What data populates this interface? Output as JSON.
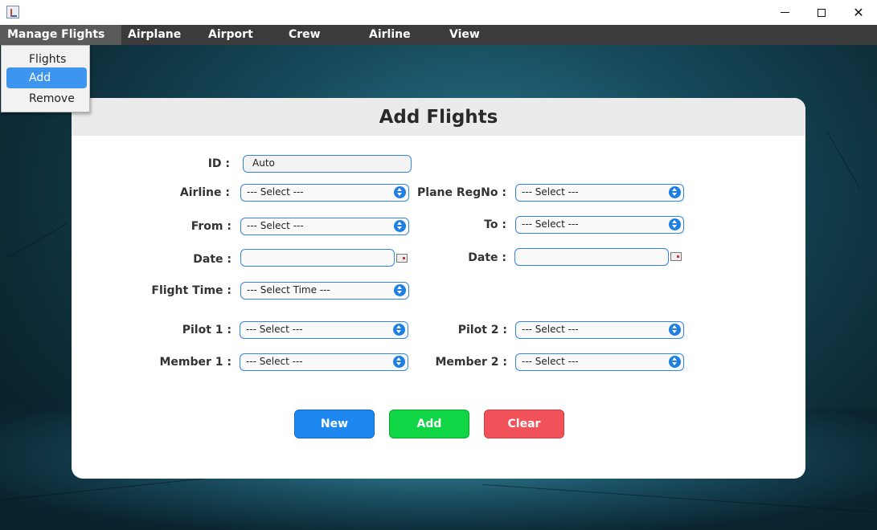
{
  "window": {
    "minimize_glyph": "",
    "close_glyph": "✕"
  },
  "menubar": {
    "items": [
      {
        "label": "Manage Flights"
      },
      {
        "label": "Airplane"
      },
      {
        "label": "Airport"
      },
      {
        "label": "Crew"
      },
      {
        "label": "Airline"
      },
      {
        "label": "View"
      }
    ]
  },
  "dropdown": {
    "items": [
      {
        "label": "Flights"
      },
      {
        "label": "Add"
      },
      {
        "label": "Remove"
      }
    ]
  },
  "form": {
    "title": "Add Flights",
    "id": {
      "label": "ID :",
      "value": "Auto"
    },
    "airline": {
      "label": "Airline :",
      "value": "--- Select ---"
    },
    "plane": {
      "label": "Plane RegNo :",
      "value": "--- Select ---"
    },
    "from": {
      "label": "From :",
      "value": "--- Select ---"
    },
    "to": {
      "label": "To :",
      "value": "--- Select ---"
    },
    "date_left": {
      "label": "Date :",
      "value": ""
    },
    "date_right": {
      "label": "Date :",
      "value": ""
    },
    "flight_time": {
      "label": "Flight Time :",
      "value": "--- Select Time ---"
    },
    "pilot1": {
      "label": "Pilot 1 :",
      "value": "--- Select ---"
    },
    "pilot2": {
      "label": "Pilot 2 :",
      "value": "--- Select ---"
    },
    "member1": {
      "label": "Member 1 :",
      "value": "--- Select ---"
    },
    "member2": {
      "label": "Member 2 :",
      "value": "--- Select ---"
    }
  },
  "buttons": {
    "new": "New",
    "add": "Add",
    "clear": "Clear"
  },
  "colors": {
    "menubar": "#3b3b3b",
    "accent_blue": "#1e88f0",
    "add_green": "#10d645",
    "clear_red": "#f2525a",
    "selected_item": "#3d95f0"
  }
}
